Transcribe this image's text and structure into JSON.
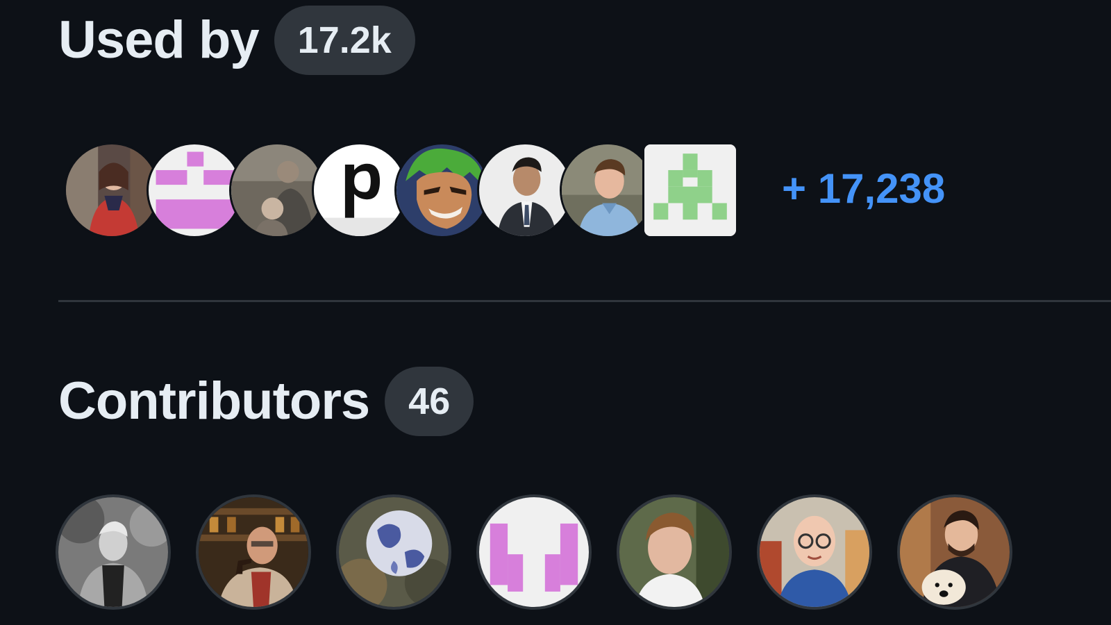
{
  "used_by": {
    "title": "Used by",
    "count": "17.2k",
    "more": "+ 17,238",
    "avatars": [
      {
        "icon": "user-avatar-photo"
      },
      {
        "icon": "identicon-pink"
      },
      {
        "icon": "user-avatar-photo"
      },
      {
        "icon": "letter-p-avatar"
      },
      {
        "icon": "green-hair-character-avatar"
      },
      {
        "icon": "user-avatar-photo"
      },
      {
        "icon": "user-avatar-photo"
      },
      {
        "icon": "identicon-green"
      }
    ]
  },
  "contributors": {
    "title": "Contributors",
    "count": "46",
    "avatars": [
      {
        "icon": "user-avatar-photo"
      },
      {
        "icon": "user-avatar-photo"
      },
      {
        "icon": "globe-avatar"
      },
      {
        "icon": "identicon-pink"
      },
      {
        "icon": "user-avatar-photo"
      },
      {
        "icon": "user-avatar-photo"
      },
      {
        "icon": "user-avatar-photo"
      }
    ]
  },
  "colors": {
    "background": "#0d1117",
    "text": "#e6edf3",
    "counter_bg": "#30363d",
    "link": "#4493f8",
    "identicon_pink": "#d77fdb",
    "identicon_green": "#8fd18a"
  }
}
